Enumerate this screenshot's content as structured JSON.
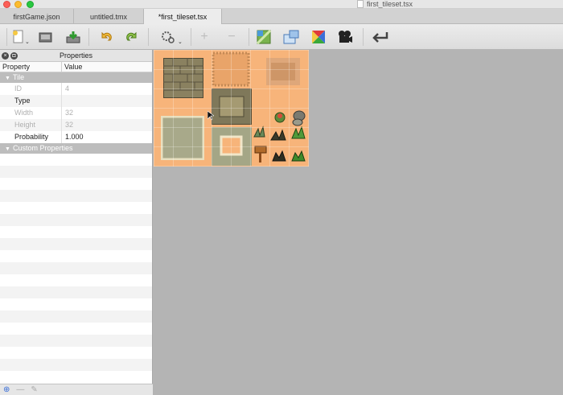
{
  "window": {
    "title": "first_tileset.tsx"
  },
  "tabs": [
    {
      "label": "firstGame.json"
    },
    {
      "label": "untitled.tmx"
    },
    {
      "label": "*first_tileset.tsx"
    }
  ],
  "toolbar": {
    "items": [
      "new-document-icon",
      "open-icon",
      "save-icon",
      "undo-icon",
      "redo-icon",
      "tileset-properties-icon",
      "add-tiles-icon",
      "remove-tiles-icon",
      "edit-terrain-icon",
      "edit-collision-icon",
      "edit-wang-sets-icon",
      "animation-editor-icon",
      "dynamic-wrapping-icon"
    ],
    "dropdown_glyph": "⌄",
    "add_glyph": "+",
    "remove_glyph": "−"
  },
  "properties": {
    "title": "Properties",
    "columns": {
      "property": "Property",
      "value": "Value"
    },
    "tile_group": "Tile",
    "rows": [
      {
        "key": "ID",
        "value": "4"
      },
      {
        "key": "Type",
        "value": ""
      },
      {
        "key": "Width",
        "value": "32"
      },
      {
        "key": "Height",
        "value": "32"
      },
      {
        "key": "Probability",
        "value": "1.000"
      }
    ],
    "custom_group": "Custom Properties",
    "group_triangle": "▼",
    "footer": {
      "add": "⊕",
      "remove": "—",
      "edit": "✎"
    },
    "header_buttons": {
      "close": "×",
      "float": "◘"
    }
  },
  "colors": {
    "tileset_background": "#f7b47a",
    "canvas_background": "#b4b4b4",
    "group_header": "#bdbdbd"
  }
}
